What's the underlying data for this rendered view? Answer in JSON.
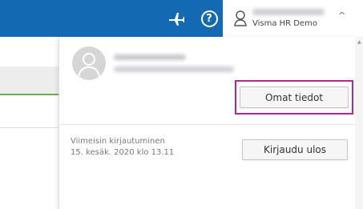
{
  "header": {
    "help_symbol": "?",
    "user": {
      "company": "Visma HR Demo"
    }
  },
  "dropdown": {
    "profile_button": "Omat tiedot",
    "last_login_label": "Viimeisin kirjautuminen",
    "last_login_value": "15. kesäk. 2020 klo 13.11",
    "logout_button": "Kirjaudu ulos"
  },
  "colors": {
    "header_bg": "#1469b3",
    "highlight_border": "#b02a8d",
    "active_underline": "#6ab04c"
  },
  "icons": [
    "airplane-icon",
    "help-icon",
    "user-icon",
    "chevron-up-icon",
    "avatar-placeholder-icon",
    "scroll-up-arrow-icon"
  ]
}
